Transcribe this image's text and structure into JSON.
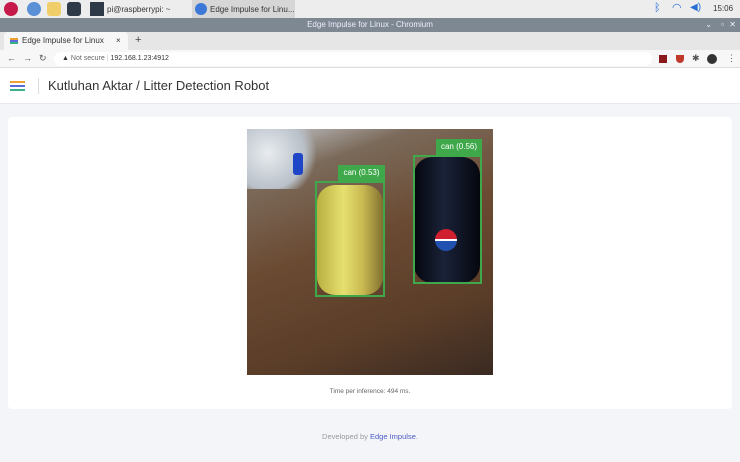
{
  "taskbar": {
    "terminal_label": "pi@raspberrypi: ~",
    "browser_task": "Edge Impulse for Linu...",
    "clock": "15:06"
  },
  "window": {
    "title": "Edge Impulse for Linux - Chromium"
  },
  "tab": {
    "label": "Edge Impulse for Linux",
    "close": "×",
    "new": "+"
  },
  "address": {
    "security": "Not secure",
    "url": "192.168.1.23:4912"
  },
  "header": {
    "title": "Kutluhan Aktar / Litter Detection Robot"
  },
  "detections": [
    {
      "label": "can (0.53)",
      "score": 0.53
    },
    {
      "label": "can (0.56)",
      "score": 0.56
    }
  ],
  "inference": {
    "text": "Time per inference: 494 ms."
  },
  "footer": {
    "prefix": "Developed by",
    "link": "Edge Impulse",
    "suffix": "."
  },
  "colors": {
    "box": "#3ea84a",
    "link": "#4a5bc4"
  }
}
